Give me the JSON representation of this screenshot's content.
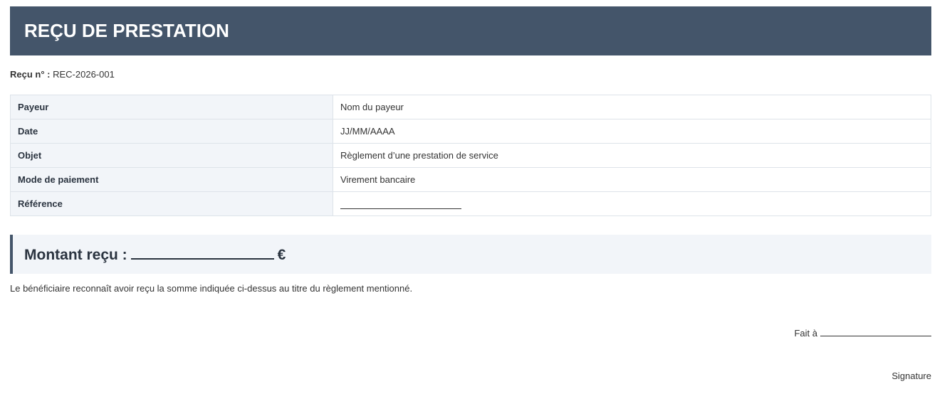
{
  "header": {
    "title": "REÇU DE PRESTATION"
  },
  "receipt": {
    "number_label": "Reçu n° :",
    "number_value": "REC-2026-001"
  },
  "details": [
    {
      "label": "Payeur",
      "value": "Nom du payeur"
    },
    {
      "label": "Date",
      "value": "JJ/MM/AAAA"
    },
    {
      "label": "Objet",
      "value": "Règlement d’une prestation de service"
    },
    {
      "label": "Mode de paiement",
      "value": "Virement bancaire"
    },
    {
      "label": "Référence",
      "value": ""
    }
  ],
  "amount": {
    "label": "Montant reçu :",
    "currency": "€"
  },
  "statement": "Le bénéficiaire reconnaît avoir reçu la somme indiquée ci-dessus au titre du règlement mentionné.",
  "footer": {
    "place_label": "Fait à",
    "signature_label": "Signature"
  },
  "colors": {
    "header_bg": "#44556a",
    "label_cell_bg": "#f2f5f9",
    "border": "#dde3e9",
    "accent_bar": "#44556a"
  }
}
